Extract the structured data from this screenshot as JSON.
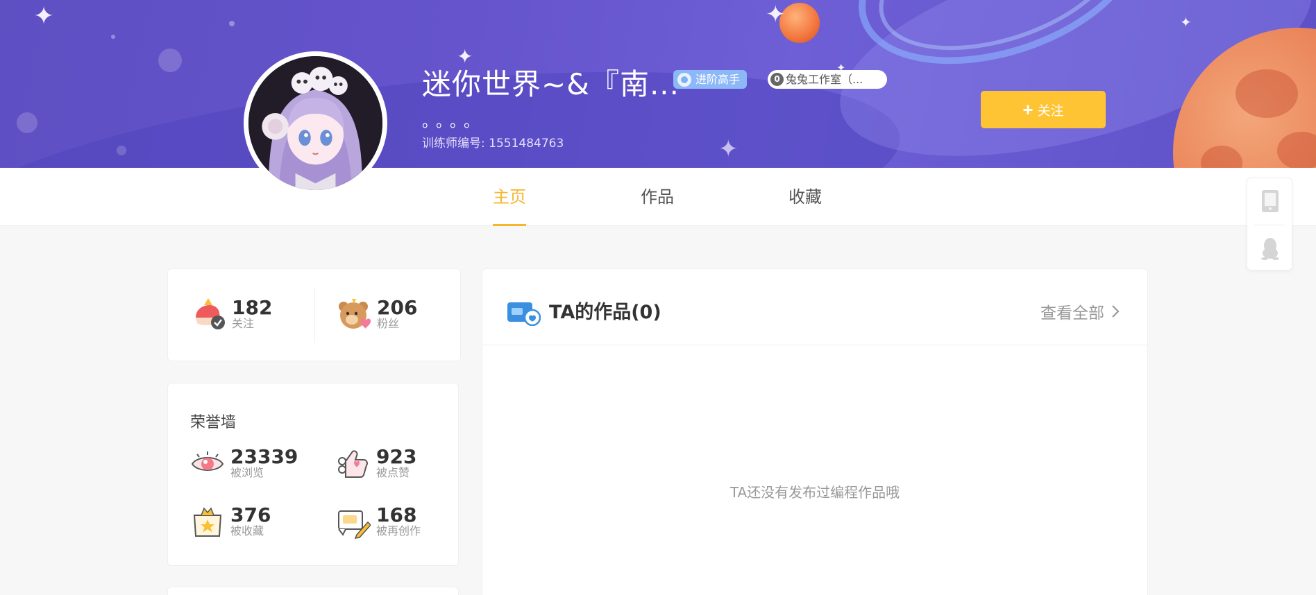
{
  "profile": {
    "username": "迷你世界~&『南...",
    "level_badge": "进阶高手",
    "studio_count": "0",
    "studio_badge": "兔兔工作室（...",
    "signature": "。。。。",
    "trainer_id_label": "训练师编号: 1551484763",
    "follow_label": "关注",
    "follow_plus": "+"
  },
  "tabs": [
    {
      "label": "主页",
      "active": true
    },
    {
      "label": "作品",
      "active": false
    },
    {
      "label": "收藏",
      "active": false
    }
  ],
  "social": {
    "following": {
      "count": "182",
      "label": "关注"
    },
    "fans": {
      "count": "206",
      "label": "粉丝"
    }
  },
  "honor_wall": {
    "title": "荣誉墙",
    "views": {
      "count": "23339",
      "label": "被浏览"
    },
    "likes": {
      "count": "923",
      "label": "被点赞"
    },
    "favorites": {
      "count": "376",
      "label": "被收藏"
    },
    "remixes": {
      "count": "168",
      "label": "被再创作"
    }
  },
  "works": {
    "title": "TA的作品(0)",
    "view_all": "查看全部",
    "empty_message": "TA还没有发布过编程作品哦"
  },
  "side_toolbar": {
    "icons": [
      "mobile-icon",
      "qq-icon"
    ]
  },
  "colors": {
    "accent": "#f7b62c",
    "follow_button": "#fec433",
    "banner": "#6554cc"
  }
}
